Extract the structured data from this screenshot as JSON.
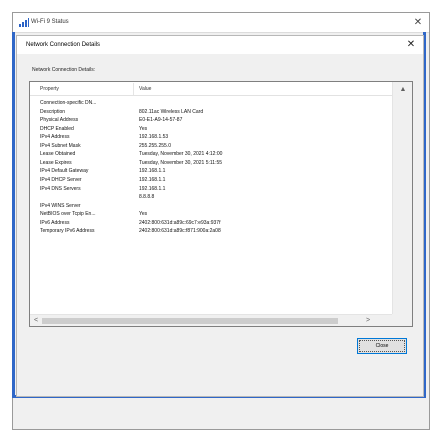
{
  "wifi_window": {
    "title": "Wi-Fi 9 Status",
    "close_glyph": "✕"
  },
  "dialog": {
    "title": "Network Connection Details",
    "close_glyph": "✕",
    "section_label": "Network Connection Details:",
    "columns": {
      "property": "Property",
      "value": "Value"
    },
    "rows": [
      {
        "property": "Connection-specific DN...",
        "value": ""
      },
      {
        "property": "Description",
        "value": "802.11ac Wireless LAN Card"
      },
      {
        "property": "Physical Address",
        "value": "E0-E1-A9-14-57-87"
      },
      {
        "property": "DHCP Enabled",
        "value": "Yes"
      },
      {
        "property": "IPv4 Address",
        "value": "192.168.1.53"
      },
      {
        "property": "IPv4 Subnet Mask",
        "value": "255.255.255.0"
      },
      {
        "property": "Lease Obtained",
        "value": "Tuesday, November 30, 2021 4:12:00"
      },
      {
        "property": "Lease Expires",
        "value": "Tuesday, November 30, 2021 5:11:55"
      },
      {
        "property": "IPv4 Default Gateway",
        "value": "192.168.1.1"
      },
      {
        "property": "IPv4 DHCP Server",
        "value": "192.168.1.1"
      },
      {
        "property": "IPv4 DNS Servers",
        "value": "192.168.1.1"
      },
      {
        "property": "",
        "value": "8.8.8.8"
      },
      {
        "property": "IPv4 WINS Server",
        "value": ""
      },
      {
        "property": "NetBIOS over Tcpip En...",
        "value": "Yes"
      },
      {
        "property": "IPv6 Address",
        "value": "2402:800:631d:a89c:69c7:e93a:937f"
      },
      {
        "property": "Temporary IPv6 Address",
        "value": "2402:800:631d:a89c:f871:900a:2a08"
      }
    ],
    "close_button_label": "Close"
  },
  "scroll_glyphs": {
    "up": "▲",
    "left": "<",
    "right": ">"
  },
  "colors": {
    "accent": "#2f67c8",
    "button_focus": "#0078d7"
  }
}
